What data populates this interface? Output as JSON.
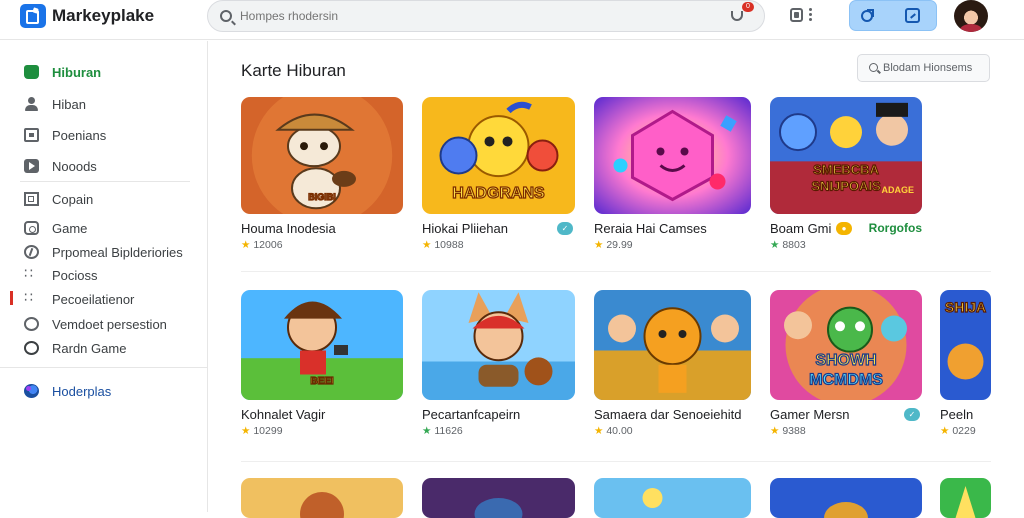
{
  "header": {
    "brand": "Markeyplake",
    "search_placeholder": "Hompes rhodersin",
    "mic_badge": "0"
  },
  "sidebar": {
    "items": [
      {
        "label": "Hiburan",
        "icon": "home-icon",
        "active": true
      },
      {
        "label": "Hiban",
        "icon": "person-icon"
      },
      {
        "label": "Poenians",
        "icon": "grid-icon"
      },
      {
        "label": "Nooods",
        "icon": "video-icon"
      },
      {
        "label": "Copain",
        "icon": "frame-icon"
      },
      {
        "label": "Game",
        "icon": "gamepad-icon"
      },
      {
        "label": "Prpomeal Biplderiories",
        "icon": "bolt-icon"
      },
      {
        "label": "Pocioss",
        "icon": "dots-icon"
      },
      {
        "label": "Pecoeilatienor",
        "icon": "dots-icon"
      },
      {
        "label": "Vemdoet persestion",
        "icon": "circle-icon"
      },
      {
        "label": "Rardn Game",
        "icon": "circle-icon"
      },
      {
        "label": "Hoderplas",
        "icon": "globe-icon"
      }
    ]
  },
  "main": {
    "title": "Karte Hiburan",
    "filter_label": "Blodam Hionsems",
    "rows": [
      [
        {
          "title": "Houma Inodesia",
          "rating": "12006",
          "art": "explorer",
          "thumb_text": "BIGIBI"
        },
        {
          "title": "Hiokai Pliiehan",
          "rating": "10988",
          "art": "blob",
          "thumb_text": "HADGRANS",
          "badge": "check"
        },
        {
          "title": "Reraia Hai Camses",
          "rating": "29.99",
          "art": "gem"
        },
        {
          "title": "Boam Gmi",
          "rating": "8803",
          "art": "party",
          "thumb_text": "SMEBCBA SNIJPOAIS",
          "thumb_text2": "ADAGE",
          "badge": "coin",
          "extra": "Rorgofos",
          "green": true
        }
      ],
      [
        {
          "title": "Kohnalet Vagir",
          "rating": "10299",
          "art": "boy",
          "thumb_text": "BEEI"
        },
        {
          "title": "Pecartanfcapeirn",
          "rating": "11626",
          "art": "fox",
          "green": true
        },
        {
          "title": "Samaera dar Senoeiehitd",
          "rating": "40.00",
          "art": "dog"
        },
        {
          "title": "Gamer Mersn",
          "rating": "9388",
          "art": "monster",
          "thumb_text": "SHOWH MCMDMS",
          "badge": "check"
        },
        {
          "title": "Peeln",
          "rating": "0229",
          "art": "partial",
          "thumb_text": "SHIJA"
        }
      ],
      [
        {
          "art": "bear"
        },
        {
          "art": "cap"
        },
        {
          "art": "beach"
        },
        {
          "art": "bird"
        },
        {
          "art": "greenpartial"
        }
      ]
    ]
  },
  "colors": {
    "accent": "#1a73e8",
    "active_nav": "#1e8e3e",
    "star": "#f4b400",
    "pill": "#a8d3fb"
  }
}
